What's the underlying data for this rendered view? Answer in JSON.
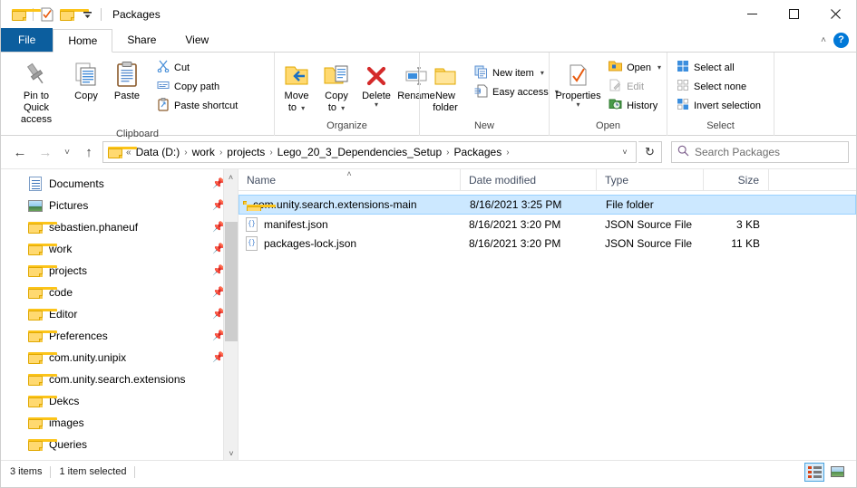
{
  "window": {
    "title": "Packages",
    "quick_access": [
      {
        "name": "folder-icon",
        "label": "Folder"
      },
      {
        "name": "properties-icon",
        "label": "Properties"
      },
      {
        "name": "new-folder-icon",
        "label": "New folder"
      },
      {
        "name": "customize-qat-icon",
        "label": "Customize Quick Access Toolbar"
      }
    ],
    "controls": {
      "minimize": "—",
      "maximize": "☐",
      "close": "✕"
    }
  },
  "tabs": [
    {
      "label": "File",
      "type": "file"
    },
    {
      "label": "Home",
      "type": "active"
    },
    {
      "label": "Share",
      "type": "normal"
    },
    {
      "label": "View",
      "type": "normal"
    }
  ],
  "ribbon": {
    "collapse_label": "˄",
    "help_label": "?",
    "groups": [
      {
        "label": "Clipboard",
        "big": [
          {
            "label1": "Pin to Quick",
            "label2": "access",
            "icon": "pin-icon"
          },
          {
            "label1": "Copy",
            "label2": "",
            "icon": "copy-icon"
          },
          {
            "label1": "Paste",
            "label2": "",
            "icon": "paste-icon"
          }
        ],
        "small": [
          {
            "label": "Cut",
            "icon": "scissors-icon",
            "dim": false
          },
          {
            "label": "Copy path",
            "icon": "copy-path-icon",
            "dim": false
          },
          {
            "label": "Paste shortcut",
            "icon": "paste-shortcut-icon",
            "dim": false
          }
        ]
      },
      {
        "label": "Organize",
        "big": [
          {
            "label1": "Move",
            "label2": "to",
            "icon": "move-to-icon",
            "caret": true
          },
          {
            "label1": "Copy",
            "label2": "to",
            "icon": "copy-to-icon",
            "caret": true
          },
          {
            "label1": "Delete",
            "label2": "",
            "icon": "delete-icon",
            "caret": true
          },
          {
            "label1": "Rename",
            "label2": "",
            "icon": "rename-icon"
          }
        ],
        "small": []
      },
      {
        "label": "New",
        "big": [
          {
            "label1": "New",
            "label2": "folder",
            "icon": "new-folder-icon"
          }
        ],
        "small": [
          {
            "label": "New item",
            "icon": "new-item-icon",
            "caret": true,
            "dim": false
          },
          {
            "label": "Easy access",
            "icon": "easy-access-icon",
            "caret": true,
            "dim": false
          }
        ]
      },
      {
        "label": "Open",
        "big": [
          {
            "label1": "Properties",
            "label2": "",
            "icon": "properties-icon",
            "caret": true
          }
        ],
        "small": [
          {
            "label": "Open",
            "icon": "open-icon",
            "caret": true,
            "dim": false
          },
          {
            "label": "Edit",
            "icon": "edit-icon",
            "dim": true
          },
          {
            "label": "History",
            "icon": "history-icon",
            "dim": false
          }
        ]
      },
      {
        "label": "Select",
        "big": [],
        "small": [
          {
            "label": "Select all",
            "icon": "select-all-icon",
            "dim": false
          },
          {
            "label": "Select none",
            "icon": "select-none-icon",
            "dim": false
          },
          {
            "label": "Invert selection",
            "icon": "invert-selection-icon",
            "dim": false
          }
        ]
      }
    ]
  },
  "navbar": {
    "back": "←",
    "forward": "→",
    "recent": "˅",
    "up": "↑",
    "prefix": "«",
    "breadcrumbs": [
      "Data (D:)",
      "work",
      "projects",
      "Lego_20_3_Dependencies_Setup",
      "Packages"
    ],
    "separator": "›",
    "dropdown": "˅",
    "refresh": "↻",
    "search_placeholder": "Search Packages",
    "search_value": ""
  },
  "navpane": {
    "items": [
      {
        "label": "Documents",
        "icon": "documents-icon",
        "pinned": true
      },
      {
        "label": "Pictures",
        "icon": "pictures-icon",
        "pinned": true
      },
      {
        "label": "sebastien.phaneuf",
        "icon": "folder-icon",
        "pinned": true
      },
      {
        "label": "work",
        "icon": "folder-icon",
        "pinned": true
      },
      {
        "label": "projects",
        "icon": "folder-icon",
        "pinned": true
      },
      {
        "label": "code",
        "icon": "folder-icon",
        "pinned": true
      },
      {
        "label": "Editor",
        "icon": "folder-icon",
        "pinned": true
      },
      {
        "label": "Preferences",
        "icon": "folder-icon",
        "pinned": true
      },
      {
        "label": "com.unity.unipix",
        "icon": "folder-icon",
        "pinned": true
      },
      {
        "label": "com.unity.search.extensions",
        "icon": "folder-icon",
        "pinned": false
      },
      {
        "label": "Dekcs",
        "icon": "folder-icon",
        "pinned": false
      },
      {
        "label": "images",
        "icon": "folder-icon",
        "pinned": false
      },
      {
        "label": "Queries",
        "icon": "folder-icon",
        "pinned": false
      }
    ],
    "scroll_up": "˄",
    "scroll_down": "˅"
  },
  "filelist": {
    "columns": [
      {
        "label": "Name",
        "sorted": true,
        "sort_glyph": "˄"
      },
      {
        "label": "Date modified",
        "sorted": false
      },
      {
        "label": "Type",
        "sorted": false
      },
      {
        "label": "Size",
        "sorted": false
      }
    ],
    "rows": [
      {
        "name": "com.unity.search.extensions-main",
        "date": "8/16/2021 3:25 PM",
        "type": "File folder",
        "size": "",
        "icon": "folder-icon",
        "selected": true
      },
      {
        "name": "manifest.json",
        "date": "8/16/2021 3:20 PM",
        "type": "JSON Source File",
        "size": "3 KB",
        "icon": "json-file-icon",
        "selected": false
      },
      {
        "name": "packages-lock.json",
        "date": "8/16/2021 3:20 PM",
        "type": "JSON Source File",
        "size": "11 KB",
        "icon": "json-file-icon",
        "selected": false
      }
    ]
  },
  "statusbar": {
    "item_count": "3 items",
    "selection": "1 item selected",
    "view_details": "Details view",
    "view_tiles": "Large icons view"
  },
  "colors": {
    "accent": "#0078d7",
    "file_tab": "#0c5e9e",
    "selection_fill": "#cce8ff",
    "selection_border": "#99d1ff",
    "folder_yellow": "#ffd970"
  }
}
